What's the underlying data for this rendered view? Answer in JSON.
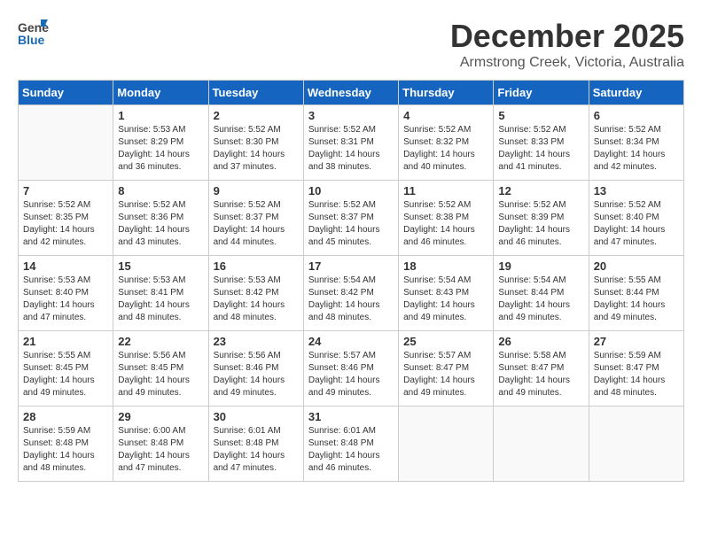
{
  "header": {
    "logo_general": "General",
    "logo_blue": "Blue",
    "month": "December 2025",
    "location": "Armstrong Creek, Victoria, Australia"
  },
  "calendar": {
    "days_of_week": [
      "Sunday",
      "Monday",
      "Tuesday",
      "Wednesday",
      "Thursday",
      "Friday",
      "Saturday"
    ],
    "weeks": [
      [
        {
          "day": "",
          "info": ""
        },
        {
          "day": "1",
          "info": "Sunrise: 5:53 AM\nSunset: 8:29 PM\nDaylight: 14 hours\nand 36 minutes."
        },
        {
          "day": "2",
          "info": "Sunrise: 5:52 AM\nSunset: 8:30 PM\nDaylight: 14 hours\nand 37 minutes."
        },
        {
          "day": "3",
          "info": "Sunrise: 5:52 AM\nSunset: 8:31 PM\nDaylight: 14 hours\nand 38 minutes."
        },
        {
          "day": "4",
          "info": "Sunrise: 5:52 AM\nSunset: 8:32 PM\nDaylight: 14 hours\nand 40 minutes."
        },
        {
          "day": "5",
          "info": "Sunrise: 5:52 AM\nSunset: 8:33 PM\nDaylight: 14 hours\nand 41 minutes."
        },
        {
          "day": "6",
          "info": "Sunrise: 5:52 AM\nSunset: 8:34 PM\nDaylight: 14 hours\nand 42 minutes."
        }
      ],
      [
        {
          "day": "7",
          "info": "Sunrise: 5:52 AM\nSunset: 8:35 PM\nDaylight: 14 hours\nand 42 minutes."
        },
        {
          "day": "8",
          "info": "Sunrise: 5:52 AM\nSunset: 8:36 PM\nDaylight: 14 hours\nand 43 minutes."
        },
        {
          "day": "9",
          "info": "Sunrise: 5:52 AM\nSunset: 8:37 PM\nDaylight: 14 hours\nand 44 minutes."
        },
        {
          "day": "10",
          "info": "Sunrise: 5:52 AM\nSunset: 8:37 PM\nDaylight: 14 hours\nand 45 minutes."
        },
        {
          "day": "11",
          "info": "Sunrise: 5:52 AM\nSunset: 8:38 PM\nDaylight: 14 hours\nand 46 minutes."
        },
        {
          "day": "12",
          "info": "Sunrise: 5:52 AM\nSunset: 8:39 PM\nDaylight: 14 hours\nand 46 minutes."
        },
        {
          "day": "13",
          "info": "Sunrise: 5:52 AM\nSunset: 8:40 PM\nDaylight: 14 hours\nand 47 minutes."
        }
      ],
      [
        {
          "day": "14",
          "info": "Sunrise: 5:53 AM\nSunset: 8:40 PM\nDaylight: 14 hours\nand 47 minutes."
        },
        {
          "day": "15",
          "info": "Sunrise: 5:53 AM\nSunset: 8:41 PM\nDaylight: 14 hours\nand 48 minutes."
        },
        {
          "day": "16",
          "info": "Sunrise: 5:53 AM\nSunset: 8:42 PM\nDaylight: 14 hours\nand 48 minutes."
        },
        {
          "day": "17",
          "info": "Sunrise: 5:54 AM\nSunset: 8:42 PM\nDaylight: 14 hours\nand 48 minutes."
        },
        {
          "day": "18",
          "info": "Sunrise: 5:54 AM\nSunset: 8:43 PM\nDaylight: 14 hours\nand 49 minutes."
        },
        {
          "day": "19",
          "info": "Sunrise: 5:54 AM\nSunset: 8:44 PM\nDaylight: 14 hours\nand 49 minutes."
        },
        {
          "day": "20",
          "info": "Sunrise: 5:55 AM\nSunset: 8:44 PM\nDaylight: 14 hours\nand 49 minutes."
        }
      ],
      [
        {
          "day": "21",
          "info": "Sunrise: 5:55 AM\nSunset: 8:45 PM\nDaylight: 14 hours\nand 49 minutes."
        },
        {
          "day": "22",
          "info": "Sunrise: 5:56 AM\nSunset: 8:45 PM\nDaylight: 14 hours\nand 49 minutes."
        },
        {
          "day": "23",
          "info": "Sunrise: 5:56 AM\nSunset: 8:46 PM\nDaylight: 14 hours\nand 49 minutes."
        },
        {
          "day": "24",
          "info": "Sunrise: 5:57 AM\nSunset: 8:46 PM\nDaylight: 14 hours\nand 49 minutes."
        },
        {
          "day": "25",
          "info": "Sunrise: 5:57 AM\nSunset: 8:47 PM\nDaylight: 14 hours\nand 49 minutes."
        },
        {
          "day": "26",
          "info": "Sunrise: 5:58 AM\nSunset: 8:47 PM\nDaylight: 14 hours\nand 49 minutes."
        },
        {
          "day": "27",
          "info": "Sunrise: 5:59 AM\nSunset: 8:47 PM\nDaylight: 14 hours\nand 48 minutes."
        }
      ],
      [
        {
          "day": "28",
          "info": "Sunrise: 5:59 AM\nSunset: 8:48 PM\nDaylight: 14 hours\nand 48 minutes."
        },
        {
          "day": "29",
          "info": "Sunrise: 6:00 AM\nSunset: 8:48 PM\nDaylight: 14 hours\nand 47 minutes."
        },
        {
          "day": "30",
          "info": "Sunrise: 6:01 AM\nSunset: 8:48 PM\nDaylight: 14 hours\nand 47 minutes."
        },
        {
          "day": "31",
          "info": "Sunrise: 6:01 AM\nSunset: 8:48 PM\nDaylight: 14 hours\nand 46 minutes."
        },
        {
          "day": "",
          "info": ""
        },
        {
          "day": "",
          "info": ""
        },
        {
          "day": "",
          "info": ""
        }
      ]
    ]
  }
}
